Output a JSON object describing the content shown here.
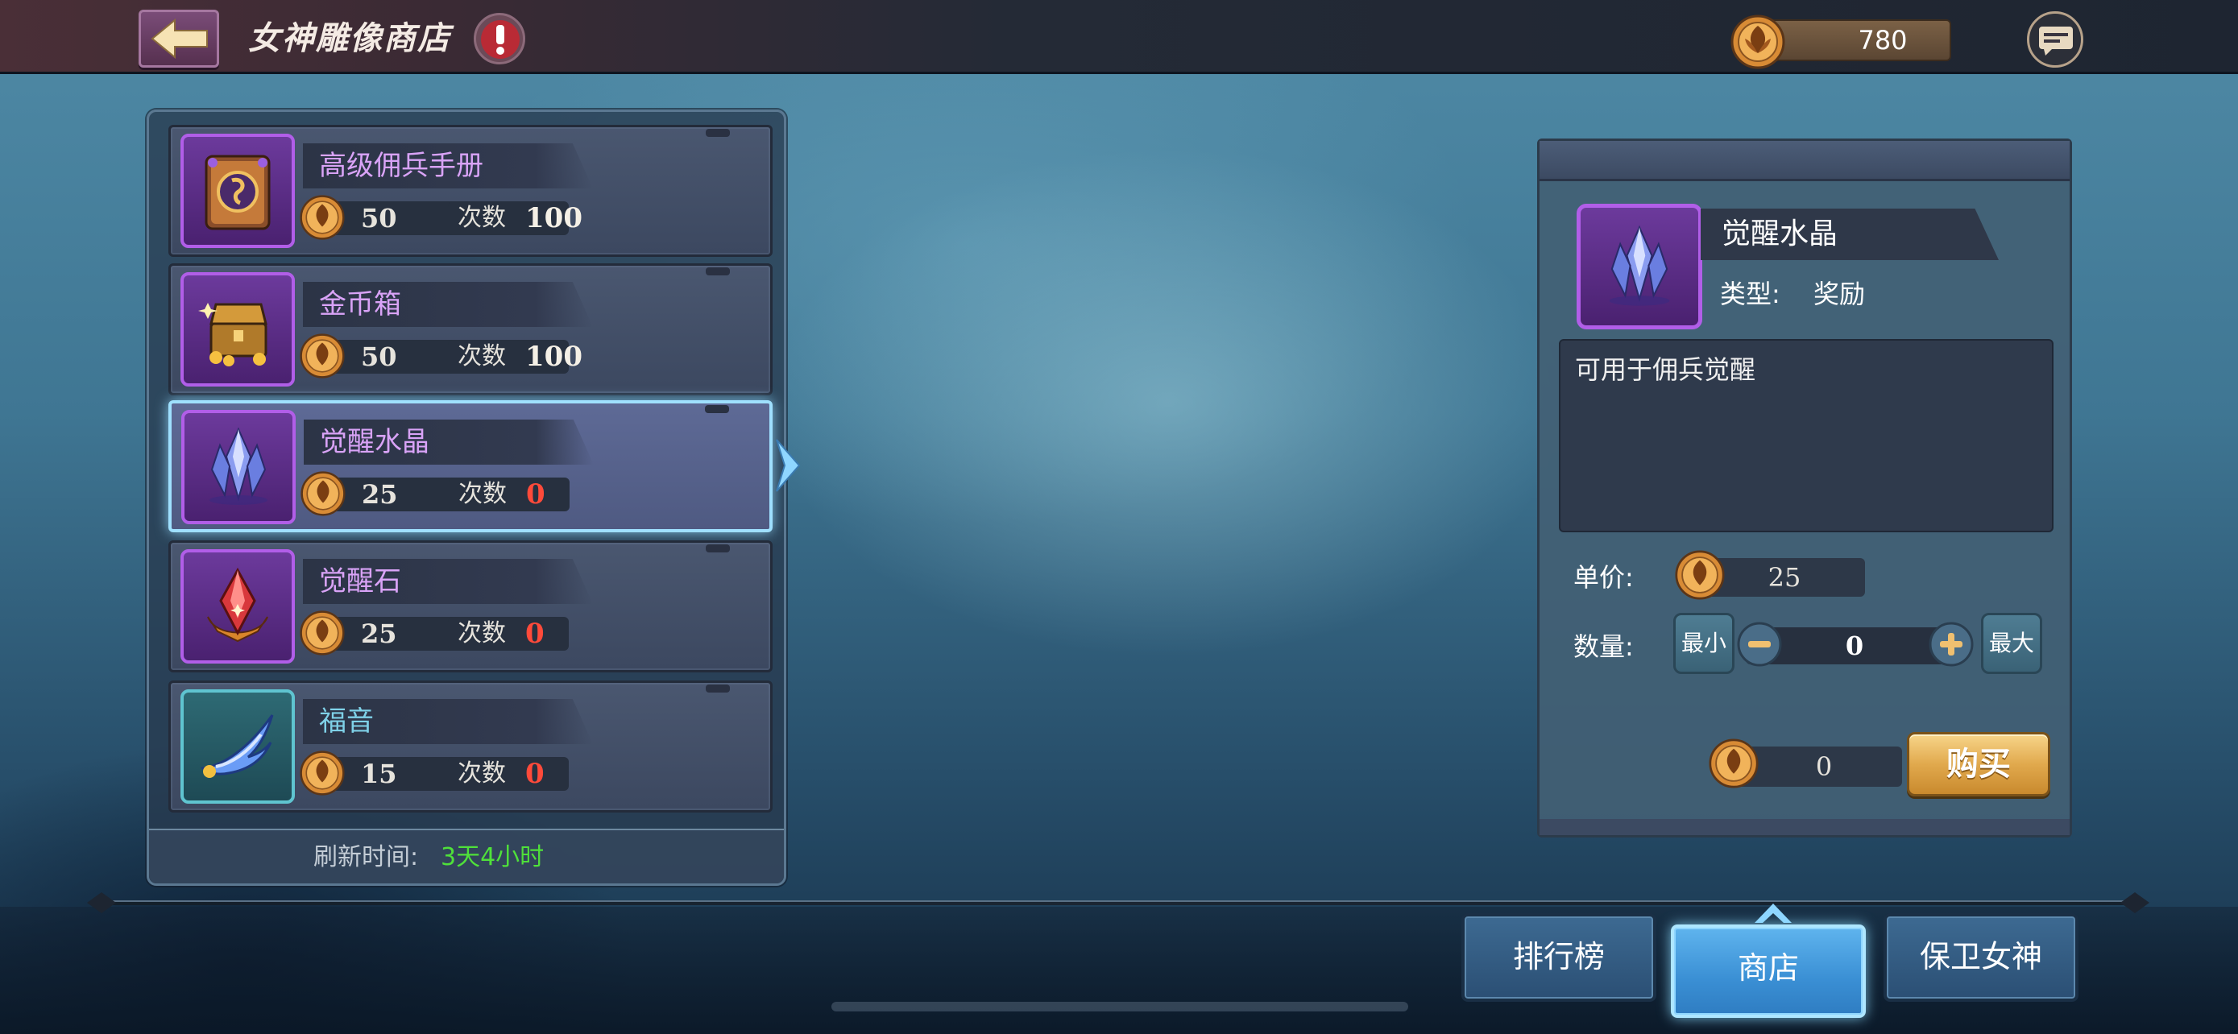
{
  "header": {
    "title": "女神雕像商店",
    "currency_amount": "780"
  },
  "shop_items": [
    {
      "name": "高级佣兵手册",
      "price": "50",
      "count_label": "次数",
      "count": "100",
      "icon": "mercenary-book-icon"
    },
    {
      "name": "金币箱",
      "price": "50",
      "count_label": "次数",
      "count": "100",
      "icon": "gold-chest-icon"
    },
    {
      "name": "觉醒水晶",
      "price": "25",
      "count_label": "次数",
      "count": "0",
      "icon": "awakening-crystal-icon",
      "selected": true
    },
    {
      "name": "觉醒石",
      "price": "25",
      "count_label": "次数",
      "count": "0",
      "icon": "awakening-stone-icon"
    },
    {
      "name": "福音",
      "price": "15",
      "count_label": "次数",
      "count": "0",
      "icon": "wing-icon"
    }
  ],
  "refresh": {
    "label": "刷新时间:",
    "value": "3天4小时"
  },
  "detail": {
    "name": "觉醒水晶",
    "type_label": "类型:",
    "type_value": "奖励",
    "description": "可用于佣兵觉醒",
    "unit_price_label": "单价:",
    "unit_price": "25",
    "quantity_label": "数量:",
    "min_label": "最小",
    "max_label": "最大",
    "quantity": "0",
    "total": "0",
    "buy_label": "购买"
  },
  "nav": {
    "leaderboard": "排行榜",
    "shop": "商店",
    "defend": "保卫女神"
  },
  "colors": {
    "accent_purple": "#b15ee8",
    "zero_count": "#ff4a3a",
    "refresh_green": "#4fe03a",
    "buy_gold": "#e1a94d"
  }
}
